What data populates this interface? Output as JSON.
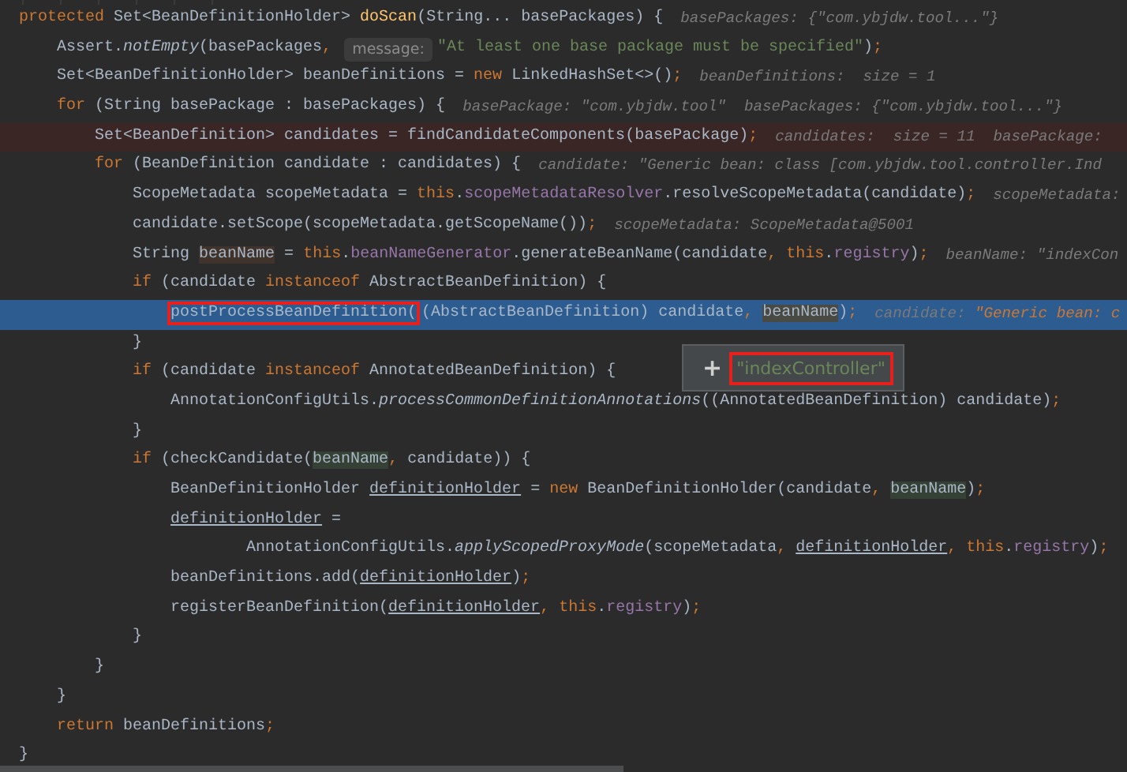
{
  "lines": [
    {
      "kind": "normal",
      "parts": [
        {
          "kind": "code",
          "tokens": [
            {
              "kind": "kw",
              "text": "protected"
            },
            {
              "kind": "plain",
              "text": " Set<BeanDefinitionHolder> "
            },
            {
              "kind": "decl",
              "text": "doScan"
            },
            {
              "kind": "plain",
              "text": "(String... basePackages) {"
            }
          ]
        },
        {
          "kind": "value-hint",
          "tokens": [
            {
              "kind": "hint",
              "text": "basePackages: {\"com.ybjdw.tool...\"}"
            }
          ]
        }
      ]
    },
    {
      "kind": "normal",
      "parts": [
        {
          "kind": "code",
          "tokens": [
            {
              "kind": "plain",
              "text": "    Assert."
            },
            {
              "kind": "static",
              "text": "notEmpty"
            },
            {
              "kind": "plain",
              "text": "(basePackages"
            },
            {
              "kind": "kw",
              "text": ", "
            }
          ]
        },
        {
          "kind": "param-hint",
          "text": "message:"
        },
        {
          "kind": "code",
          "tokens": [
            {
              "kind": "str",
              "text": "\"At least one base package must be specified\""
            },
            {
              "kind": "plain",
              "text": ")"
            },
            {
              "kind": "kw",
              "text": ";"
            }
          ]
        }
      ]
    },
    {
      "kind": "normal",
      "parts": [
        {
          "kind": "code",
          "tokens": [
            {
              "kind": "plain",
              "text": "    Set<BeanDefinitionHolder> beanDefinitions = "
            },
            {
              "kind": "kw",
              "text": "new"
            },
            {
              "kind": "plain",
              "text": " LinkedHashSet<>()"
            },
            {
              "kind": "kw",
              "text": ";"
            }
          ]
        },
        {
          "kind": "value-hint",
          "tokens": [
            {
              "kind": "hint",
              "text": "beanDefinitions:  size = 1"
            }
          ]
        }
      ]
    },
    {
      "kind": "normal",
      "parts": [
        {
          "kind": "code",
          "tokens": [
            {
              "kind": "kw",
              "text": "    for"
            },
            {
              "kind": "plain",
              "text": " (String basePackage : basePackages) {"
            }
          ]
        },
        {
          "kind": "value-hint",
          "tokens": [
            {
              "kind": "hint",
              "text": "basePackage: \"com.ybjdw.tool\"  basePackages: {\"com.ybjdw.tool...\"}"
            }
          ]
        }
      ]
    },
    {
      "kind": "breakpoint",
      "parts": [
        {
          "kind": "code",
          "tokens": [
            {
              "kind": "plain",
              "text": "        Set<BeanDefinition> candidates = findCandidateComponents(basePackage)"
            },
            {
              "kind": "kw",
              "text": ";"
            }
          ]
        },
        {
          "kind": "value-hint",
          "tokens": [
            {
              "kind": "hint",
              "text": "candidates:  size = 11  basePackage:"
            }
          ]
        }
      ]
    },
    {
      "kind": "normal",
      "parts": [
        {
          "kind": "code",
          "tokens": [
            {
              "kind": "kw",
              "text": "        for"
            },
            {
              "kind": "plain",
              "text": " (BeanDefinition candidate : candidates) {"
            }
          ]
        },
        {
          "kind": "value-hint",
          "tokens": [
            {
              "kind": "hint",
              "text": "candidate: \"Generic bean: class [com.ybjdw.tool.controller.Ind"
            }
          ]
        }
      ]
    },
    {
      "kind": "normal",
      "parts": [
        {
          "kind": "code",
          "tokens": [
            {
              "kind": "plain",
              "text": "            ScopeMetadata scopeMetadata = "
            },
            {
              "kind": "kw",
              "text": "this"
            },
            {
              "kind": "plain",
              "text": "."
            },
            {
              "kind": "field",
              "text": "scopeMetadataResolver"
            },
            {
              "kind": "plain",
              "text": ".resolveScopeMetadata(candidate)"
            },
            {
              "kind": "kw",
              "text": ";"
            }
          ]
        },
        {
          "kind": "value-hint",
          "tokens": [
            {
              "kind": "hint",
              "text": "scopeMetadata:"
            }
          ]
        }
      ]
    },
    {
      "kind": "normal",
      "parts": [
        {
          "kind": "code",
          "tokens": [
            {
              "kind": "plain",
              "text": "            candidate.setScope(scopeMetadata.getScopeName())"
            },
            {
              "kind": "kw",
              "text": ";"
            }
          ]
        },
        {
          "kind": "value-hint",
          "tokens": [
            {
              "kind": "hint",
              "text": "scopeMetadata: ScopeMetadata@5001"
            }
          ]
        }
      ]
    },
    {
      "kind": "normal",
      "parts": [
        {
          "kind": "code",
          "tokens": [
            {
              "kind": "plain",
              "text": "            String "
            },
            {
              "kind": "usage-write",
              "text": "beanName"
            },
            {
              "kind": "plain",
              "text": " = "
            },
            {
              "kind": "kw",
              "text": "this"
            },
            {
              "kind": "plain",
              "text": "."
            },
            {
              "kind": "field",
              "text": "beanNameGenerator"
            },
            {
              "kind": "plain",
              "text": ".generateBeanName(candidate"
            },
            {
              "kind": "kw",
              "text": ", this"
            },
            {
              "kind": "plain",
              "text": "."
            },
            {
              "kind": "field",
              "text": "registry"
            },
            {
              "kind": "plain",
              "text": ")"
            },
            {
              "kind": "kw",
              "text": ";"
            }
          ]
        },
        {
          "kind": "value-hint",
          "tokens": [
            {
              "kind": "hint",
              "text": "beanName: \"indexCon"
            }
          ]
        }
      ]
    },
    {
      "kind": "normal",
      "parts": [
        {
          "kind": "code",
          "tokens": [
            {
              "kind": "kw",
              "text": "            if"
            },
            {
              "kind": "plain",
              "text": " (candidate "
            },
            {
              "kind": "kw",
              "text": "instanceof"
            },
            {
              "kind": "plain",
              "text": " AbstractBeanDefinition) {"
            }
          ]
        }
      ]
    },
    {
      "kind": "execution",
      "parts": [
        {
          "kind": "code",
          "tokens": [
            {
              "kind": "boxed",
              "text": "                postProcessBeanDefinition("
            },
            {
              "kind": "plain",
              "text": "(AbstractBeanDefinition) candidate"
            },
            {
              "kind": "kw",
              "text": ", "
            },
            {
              "kind": "usage-current",
              "text": "beanName"
            },
            {
              "kind": "plain",
              "text": ")"
            },
            {
              "kind": "kw",
              "text": ";"
            }
          ]
        },
        {
          "kind": "value-hint",
          "tokens": [
            {
              "kind": "hint",
              "text": "candidate: "
            },
            {
              "kind": "hint-str",
              "text": "\"Generic bean: c"
            }
          ]
        }
      ]
    },
    {
      "kind": "normal",
      "parts": [
        {
          "kind": "code",
          "tokens": [
            {
              "kind": "plain",
              "text": "            }"
            }
          ]
        }
      ]
    },
    {
      "kind": "normal",
      "parts": [
        {
          "kind": "code",
          "tokens": [
            {
              "kind": "kw",
              "text": "            if"
            },
            {
              "kind": "plain",
              "text": " (candidate "
            },
            {
              "kind": "kw",
              "text": "instanceof"
            },
            {
              "kind": "plain",
              "text": " AnnotatedBeanDefinition) {"
            }
          ]
        }
      ]
    },
    {
      "kind": "normal",
      "parts": [
        {
          "kind": "code",
          "tokens": [
            {
              "kind": "plain",
              "text": "                AnnotationConfigUtils."
            },
            {
              "kind": "static",
              "text": "processCommonDefinitionAnnotations"
            },
            {
              "kind": "plain",
              "text": "((AnnotatedBeanDefinition) candidate)"
            },
            {
              "kind": "kw",
              "text": ";"
            }
          ]
        }
      ]
    },
    {
      "kind": "normal",
      "parts": [
        {
          "kind": "code",
          "tokens": [
            {
              "kind": "plain",
              "text": "            }"
            }
          ]
        }
      ]
    },
    {
      "kind": "normal",
      "parts": [
        {
          "kind": "code",
          "tokens": [
            {
              "kind": "kw",
              "text": "            if"
            },
            {
              "kind": "plain",
              "text": " (checkCandidate("
            },
            {
              "kind": "usage-read",
              "text": "beanName"
            },
            {
              "kind": "kw",
              "text": ","
            },
            {
              "kind": "plain",
              "text": " candidate)) {"
            }
          ]
        }
      ]
    },
    {
      "kind": "normal",
      "parts": [
        {
          "kind": "code",
          "tokens": [
            {
              "kind": "plain",
              "text": "                BeanDefinitionHolder "
            },
            {
              "kind": "underlined",
              "text": "definitionHolder"
            },
            {
              "kind": "plain",
              "text": " = "
            },
            {
              "kind": "kw",
              "text": "new"
            },
            {
              "kind": "plain",
              "text": " BeanDefinitionHolder(candidate"
            },
            {
              "kind": "kw",
              "text": ", "
            },
            {
              "kind": "usage-read",
              "text": "beanName"
            },
            {
              "kind": "plain",
              "text": ")"
            },
            {
              "kind": "kw",
              "text": ";"
            }
          ]
        }
      ]
    },
    {
      "kind": "normal",
      "parts": [
        {
          "kind": "code",
          "tokens": [
            {
              "kind": "underlined-indented",
              "text": "                definitionHolder"
            },
            {
              "kind": "plain",
              "text": " ="
            }
          ]
        }
      ]
    },
    {
      "kind": "normal",
      "parts": [
        {
          "kind": "code",
          "tokens": [
            {
              "kind": "plain",
              "text": "                        AnnotationConfigUtils."
            },
            {
              "kind": "static",
              "text": "applyScopedProxyMode"
            },
            {
              "kind": "plain",
              "text": "(scopeMetadata"
            },
            {
              "kind": "kw",
              "text": ", "
            },
            {
              "kind": "underlined",
              "text": "definitionHolder"
            },
            {
              "kind": "kw",
              "text": ", this"
            },
            {
              "kind": "plain",
              "text": "."
            },
            {
              "kind": "field",
              "text": "registry"
            },
            {
              "kind": "plain",
              "text": ")"
            },
            {
              "kind": "kw",
              "text": ";"
            }
          ]
        }
      ]
    },
    {
      "kind": "normal",
      "parts": [
        {
          "kind": "code",
          "tokens": [
            {
              "kind": "plain",
              "text": "                beanDefinitions.add("
            },
            {
              "kind": "underlined",
              "text": "definitionHolder"
            },
            {
              "kind": "plain",
              "text": ")"
            },
            {
              "kind": "kw",
              "text": ";"
            }
          ]
        }
      ]
    },
    {
      "kind": "normal",
      "parts": [
        {
          "kind": "code",
          "tokens": [
            {
              "kind": "plain",
              "text": "                registerBeanDefinition("
            },
            {
              "kind": "underlined",
              "text": "definitionHolder"
            },
            {
              "kind": "kw",
              "text": ", this"
            },
            {
              "kind": "plain",
              "text": "."
            },
            {
              "kind": "field",
              "text": "registry"
            },
            {
              "kind": "plain",
              "text": ")"
            },
            {
              "kind": "kw",
              "text": ";"
            }
          ]
        }
      ]
    },
    {
      "kind": "normal",
      "parts": [
        {
          "kind": "code",
          "tokens": [
            {
              "kind": "plain",
              "text": "            }"
            }
          ]
        }
      ]
    },
    {
      "kind": "normal",
      "parts": [
        {
          "kind": "code",
          "tokens": [
            {
              "kind": "plain",
              "text": "        }"
            }
          ]
        }
      ]
    },
    {
      "kind": "normal",
      "parts": [
        {
          "kind": "code",
          "tokens": [
            {
              "kind": "plain",
              "text": "    }"
            }
          ]
        }
      ]
    },
    {
      "kind": "normal",
      "parts": [
        {
          "kind": "code",
          "tokens": [
            {
              "kind": "kw",
              "text": "    return"
            },
            {
              "kind": "plain",
              "text": " beanDefinitions"
            },
            {
              "kind": "kw",
              "text": ";"
            }
          ]
        }
      ]
    },
    {
      "kind": "normal",
      "parts": [
        {
          "kind": "code",
          "tokens": [
            {
              "kind": "plain",
              "text": "}"
            }
          ]
        }
      ]
    }
  ],
  "tooltip": {
    "expand": "+",
    "value": "\"indexController\"",
    "value_boxed": true
  }
}
